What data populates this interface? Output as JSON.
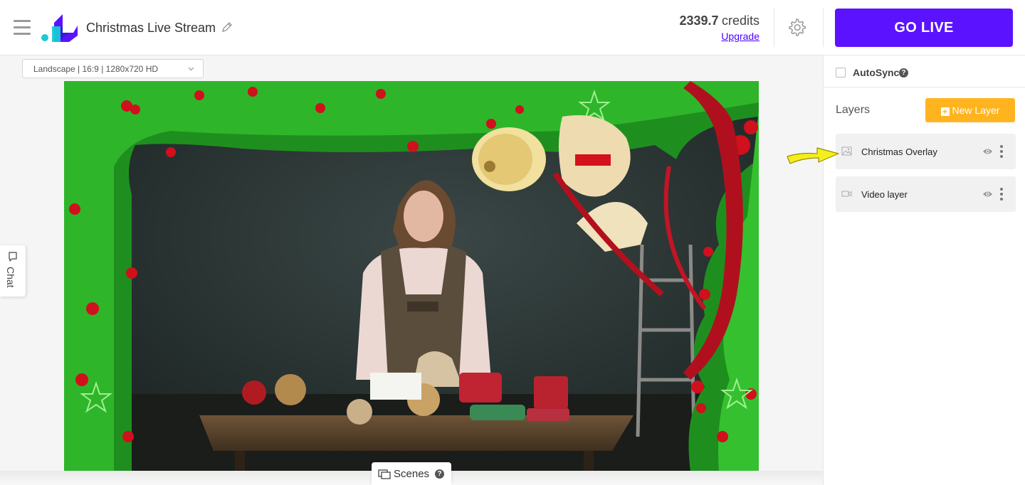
{
  "header": {
    "title": "Christmas Live Stream",
    "credits_amount": "2339.7",
    "credits_label": "credits",
    "upgrade_label": "Upgrade",
    "go_live_label": "GO LIVE"
  },
  "canvas": {
    "resolution": "Landscape | 16:9 | 1280x720 HD"
  },
  "chat": {
    "label": "Chat"
  },
  "scenes": {
    "label": "Scenes",
    "help": "?"
  },
  "right_panel": {
    "autosync_label": "AutoSync",
    "autosync_checked": false,
    "autosync_help": "?",
    "layers_title": "Layers",
    "new_layer_label": "New Layer",
    "layers": [
      {
        "name": "Christmas Overlay",
        "icon": "image-icon"
      },
      {
        "name": "Video layer",
        "icon": "video-camera-icon"
      }
    ]
  },
  "colors": {
    "brand": "#5b12ff",
    "accent": "#ffb41f",
    "link": "#4a00ff",
    "pointer": "#f4ee1c"
  },
  "icons": {
    "menu": "hamburger-icon",
    "settings": "gear-icon",
    "edit": "pencil-icon",
    "visibility": "eye-icon",
    "more": "kebab-menu-icon"
  }
}
